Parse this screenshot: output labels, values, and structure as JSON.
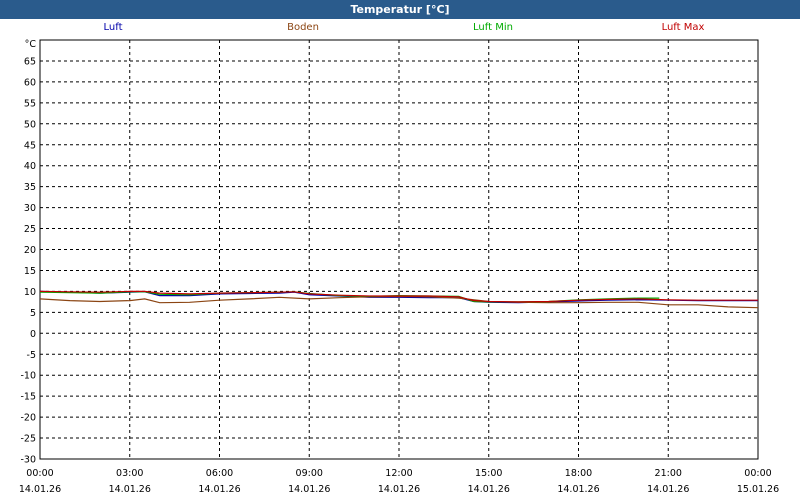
{
  "window": {
    "title": "Temperatur [°C]"
  },
  "chart_data": {
    "type": "line",
    "title": "Temperatur [°C]",
    "ylabel": "°C",
    "xlabel": "",
    "ylim": [
      -30,
      70
    ],
    "yticks": [
      "65",
      "60",
      "55",
      "50",
      "45",
      "40",
      "35",
      "30",
      "25",
      "20",
      "15",
      "10",
      "5",
      "0",
      "-5",
      "-10",
      "-15",
      "-20",
      "-25",
      "-30"
    ],
    "xlim": [
      0,
      24
    ],
    "xticks": [
      {
        "time": "00:00",
        "date": "14.01.26"
      },
      {
        "time": "03:00",
        "date": "14.01.26"
      },
      {
        "time": "06:00",
        "date": "14.01.26"
      },
      {
        "time": "09:00",
        "date": "14.01.26"
      },
      {
        "time": "12:00",
        "date": "14.01.26"
      },
      {
        "time": "15:00",
        "date": "14.01.26"
      },
      {
        "time": "18:00",
        "date": "14.01.26"
      },
      {
        "time": "21:00",
        "date": "14.01.26"
      },
      {
        "time": "00:00",
        "date": "15.01.26"
      }
    ],
    "grid": true,
    "legend_position": "top",
    "series": [
      {
        "name": "Luft",
        "color": "#0000aa",
        "x": [
          0,
          1,
          2,
          3,
          3.5,
          4,
          5,
          6,
          7,
          8,
          8.5,
          9,
          10,
          11,
          12,
          13,
          14,
          14.5,
          15,
          16,
          17,
          18,
          19,
          20,
          21,
          22,
          23,
          24
        ],
        "y": [
          10,
          9.8,
          9.6,
          9.8,
          9.9,
          9,
          9,
          9.4,
          9.5,
          9.6,
          9.8,
          9.2,
          8.9,
          8.6,
          8.6,
          8.5,
          8.5,
          7.6,
          7.4,
          7.3,
          7.5,
          7.7,
          7.9,
          8,
          7.9,
          7.8,
          7.8,
          7.8
        ]
      },
      {
        "name": "Boden",
        "color": "#8b4513",
        "x": [
          0,
          1,
          2,
          3,
          3.5,
          4,
          5,
          6,
          7,
          8,
          9,
          10,
          11,
          12,
          13,
          14,
          15,
          16,
          17,
          18,
          19,
          20,
          21,
          22,
          23,
          24
        ],
        "y": [
          8.2,
          7.8,
          7.6,
          7.8,
          8.2,
          7.3,
          7.4,
          7.9,
          8.2,
          8.6,
          8.2,
          8.5,
          8.7,
          8.8,
          8.7,
          8.4,
          7.6,
          7.4,
          7.3,
          7.3,
          7.4,
          7.4,
          6.8,
          6.8,
          6.3,
          6.1
        ]
      },
      {
        "name": "Luft Min",
        "color": "#00aa00",
        "x": [
          0,
          1,
          2,
          3,
          3.5,
          4,
          5,
          6,
          7,
          8,
          8.5,
          9,
          10,
          11,
          12,
          13,
          14,
          14.5,
          15,
          16,
          17,
          18,
          19,
          20,
          20.7
        ],
        "y": [
          9.8,
          9.7,
          9.6,
          9.9,
          9.9,
          9.3,
          9.2,
          9.6,
          9.7,
          9.8,
          9.9,
          9.5,
          9,
          8.8,
          9,
          8.9,
          8.8,
          7.6,
          7.5,
          7.5,
          7.6,
          8,
          8.2,
          8.4,
          8.4
        ]
      },
      {
        "name": "Luft Max",
        "color": "#c00000",
        "x": [
          0,
          1,
          2,
          3,
          3.5,
          4,
          5,
          6,
          7,
          8,
          8.5,
          9,
          10,
          11,
          12,
          13,
          14,
          14.5,
          15,
          16,
          17,
          18,
          19,
          20,
          21,
          22,
          23,
          24
        ],
        "y": [
          10,
          9.9,
          9.8,
          10,
          10,
          9.6,
          9.4,
          9.6,
          9.7,
          9.8,
          9.9,
          9.4,
          9.1,
          8.9,
          8.9,
          8.9,
          8.7,
          7.8,
          7.6,
          7.5,
          7.6,
          7.9,
          8.1,
          8.2,
          8,
          7.9,
          7.9,
          7.9
        ]
      }
    ]
  }
}
